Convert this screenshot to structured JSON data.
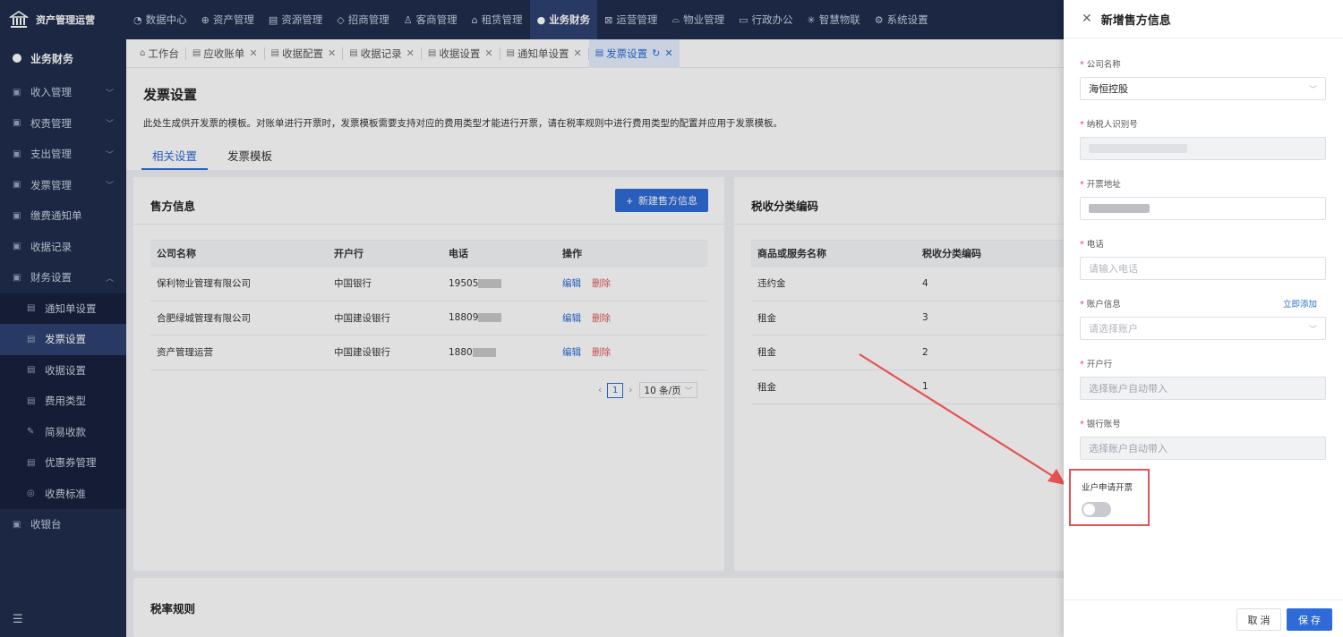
{
  "brand": {
    "name": "资产管理运营"
  },
  "topnav": [
    {
      "label": "数据中心",
      "icon": "◔",
      "active": false
    },
    {
      "label": "资产管理",
      "icon": "⊕",
      "active": false
    },
    {
      "label": "资源管理",
      "icon": "▤",
      "active": false
    },
    {
      "label": "招商管理",
      "icon": "◇",
      "active": false
    },
    {
      "label": "客商管理",
      "icon": "♙",
      "active": false
    },
    {
      "label": "租赁管理",
      "icon": "⌂",
      "active": false
    },
    {
      "label": "业务财务",
      "icon": "●",
      "active": true
    },
    {
      "label": "运营管理",
      "icon": "⊠",
      "active": false
    },
    {
      "label": "物业管理",
      "icon": "⌓",
      "active": false
    },
    {
      "label": "行政办公",
      "icon": "▭",
      "active": false
    },
    {
      "label": "智慧物联",
      "icon": "✳",
      "active": false
    },
    {
      "label": "系统设置",
      "icon": "⚙",
      "active": false
    }
  ],
  "sidebar": {
    "header": "业务财务",
    "items": [
      {
        "label": "收入管理",
        "icon": "▣",
        "expandable": true
      },
      {
        "label": "权责管理",
        "icon": "▣",
        "expandable": true
      },
      {
        "label": "支出管理",
        "icon": "▣",
        "expandable": true
      },
      {
        "label": "发票管理",
        "icon": "▣",
        "expandable": true
      },
      {
        "label": "缴费通知单",
        "icon": "▣",
        "expandable": false
      },
      {
        "label": "收据记录",
        "icon": "▣",
        "expandable": false
      },
      {
        "label": "财务设置",
        "icon": "▣",
        "expandable": true
      }
    ],
    "sub_items": [
      {
        "label": "通知单设置",
        "icon": "▤",
        "active": false
      },
      {
        "label": "发票设置",
        "icon": "▤",
        "active": true
      },
      {
        "label": "收据设置",
        "icon": "▤",
        "active": false
      },
      {
        "label": "费用类型",
        "icon": "▤",
        "active": false
      },
      {
        "label": "简易收款",
        "icon": "✎",
        "active": false
      },
      {
        "label": "优惠券管理",
        "icon": "▤",
        "active": false
      },
      {
        "label": "收费标准",
        "icon": "◎",
        "active": false
      }
    ],
    "bottom_item": {
      "label": "收银台",
      "icon": "▣"
    }
  },
  "tabs": [
    {
      "label": "工作台",
      "icon": "⌂",
      "closable": false,
      "active": false
    },
    {
      "label": "应收账单",
      "icon": "▤",
      "closable": true,
      "active": false
    },
    {
      "label": "收据配置",
      "icon": "▤",
      "closable": true,
      "active": false
    },
    {
      "label": "收据记录",
      "icon": "▤",
      "closable": true,
      "active": false
    },
    {
      "label": "收据设置",
      "icon": "▤",
      "closable": true,
      "active": false
    },
    {
      "label": "通知单设置",
      "icon": "▤",
      "closable": true,
      "active": false
    },
    {
      "label": "发票设置",
      "icon": "▤",
      "closable": true,
      "active": true
    }
  ],
  "page": {
    "title": "发票设置",
    "description": "此处生成供开发票的模板。对账单进行开票时，发票模板需要支持对应的费用类型才能进行开票，请在税率规则中进行费用类型的配置并应用于发票模板。",
    "sub_tabs": [
      "相关设置",
      "发票模板"
    ]
  },
  "seller_card": {
    "title": "售方信息",
    "new_button": "新建售方信息",
    "columns": [
      "公司名称",
      "开户行",
      "电话",
      "操作"
    ],
    "rows": [
      {
        "company": "保利物业管理有限公司",
        "bank": "中国银行",
        "phone": "19505"
      },
      {
        "company": "合肥绿城管理有限公司",
        "bank": "中国建设银行",
        "phone": "18809"
      },
      {
        "company": "资产管理运营",
        "bank": "中国建设银行",
        "phone": "1880"
      }
    ],
    "edit_label": "编辑",
    "delete_label": "删除",
    "pagination": {
      "current_page": "1",
      "page_size": "10 条/页"
    }
  },
  "tax_card": {
    "title": "税收分类编码",
    "columns": [
      "商品或服务名称",
      "税收分类编码"
    ],
    "rows": [
      {
        "name": "违约金",
        "code": "4"
      },
      {
        "name": "租金",
        "code": "3"
      },
      {
        "name": "租金",
        "code": "2"
      },
      {
        "name": "租金",
        "code": "1"
      }
    ]
  },
  "rate_card": {
    "title": "税率规则"
  },
  "drawer": {
    "title": "新增售方信息",
    "fields": {
      "company": {
        "label": "公司名称",
        "value": "海恒控股"
      },
      "taxpayer_id": {
        "label": "纳税人识别号"
      },
      "address": {
        "label": "开票地址"
      },
      "phone": {
        "label": "电话",
        "placeholder": "请输入电话"
      },
      "account": {
        "label": "账户信息",
        "placeholder": "请选择账户",
        "link": "立即添加"
      },
      "bank": {
        "label": "开户行",
        "placeholder": "选择账户自动带入"
      },
      "bank_account": {
        "label": "银行账号",
        "placeholder": "选择账户自动带入"
      }
    },
    "owner_invoice": {
      "label": "业户申请开票",
      "enabled": false
    },
    "cancel_label": "取 消",
    "save_label": "保 存"
  },
  "colors": {
    "primary": "#2f6bd8",
    "nav_bg": "#1f2d4d",
    "danger": "#e05b5b",
    "annotation": "#e65252"
  }
}
